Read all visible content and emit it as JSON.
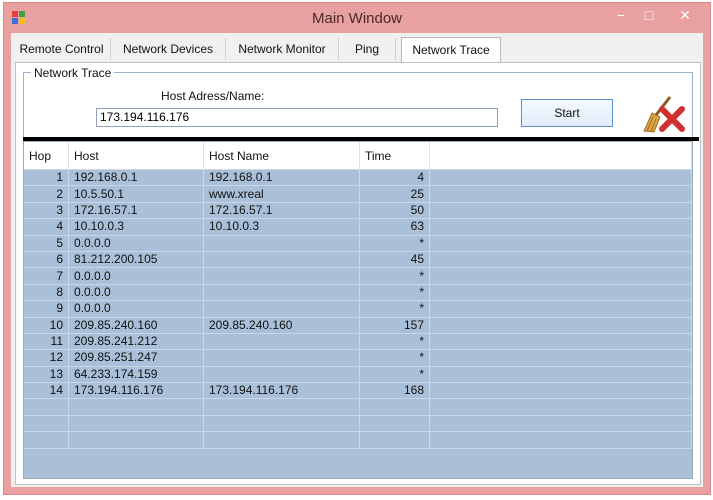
{
  "window": {
    "title": "Main Window",
    "minimize": "−",
    "maximize": "□",
    "close": "✕"
  },
  "tabs": [
    {
      "label": "Remote Control"
    },
    {
      "label": "Network Devices"
    },
    {
      "label": "Network Monitor"
    },
    {
      "label": "Ping"
    },
    {
      "label": "Network Trace",
      "active": true
    }
  ],
  "trace": {
    "group_label": "Network Trace",
    "host_label": "Host Adress/Name:",
    "host_value": "173.194.116.176",
    "start_label": "Start",
    "clear_icon": "broom-clear-icon"
  },
  "table": {
    "columns": [
      "Hop",
      "Host",
      "Host Name",
      "Time"
    ],
    "rows": [
      {
        "hop": "1",
        "host": "192.168.0.1",
        "name": "192.168.0.1",
        "time": "4"
      },
      {
        "hop": "2",
        "host": "10.5.50.1",
        "name": "www.xreal",
        "time": "25"
      },
      {
        "hop": "3",
        "host": "172.16.57.1",
        "name": "172.16.57.1",
        "time": "50"
      },
      {
        "hop": "4",
        "host": "10.10.0.3",
        "name": "10.10.0.3",
        "time": "63"
      },
      {
        "hop": "5",
        "host": "0.0.0.0",
        "name": "",
        "time": "*"
      },
      {
        "hop": "6",
        "host": "81.212.200.105",
        "name": "",
        "time": "45"
      },
      {
        "hop": "7",
        "host": "0.0.0.0",
        "name": "",
        "time": "*"
      },
      {
        "hop": "8",
        "host": "0.0.0.0",
        "name": "",
        "time": "*"
      },
      {
        "hop": "9",
        "host": "0.0.0.0",
        "name": "",
        "time": "*"
      },
      {
        "hop": "10",
        "host": "209.85.240.160",
        "name": "209.85.240.160",
        "time": "157"
      },
      {
        "hop": "11",
        "host": "209.85.241.212",
        "name": "",
        "time": "*"
      },
      {
        "hop": "12",
        "host": "209.85.251.247",
        "name": "",
        "time": "*"
      },
      {
        "hop": "13",
        "host": "64.233.174.159",
        "name": "",
        "time": "*"
      },
      {
        "hop": "14",
        "host": "173.194.116.176",
        "name": "173.194.116.176",
        "time": "168"
      }
    ]
  },
  "colors": {
    "titlebar": "#e8a0a0",
    "grid_background": "#aac0d8",
    "close_button": "#e06060"
  }
}
